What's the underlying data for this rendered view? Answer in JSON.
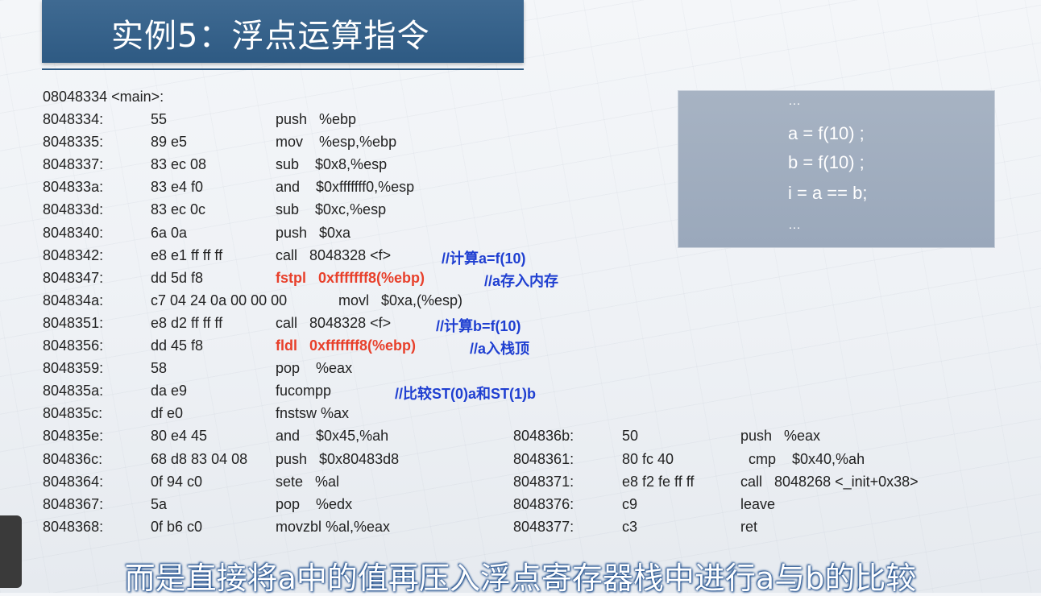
{
  "title": "实例5：浮点运算指令",
  "header_line": "08048334 <main>:",
  "code_left": [
    {
      "addr": "8048334:",
      "bytes": "55",
      "asm": "push   %ebp",
      "comment": ""
    },
    {
      "addr": "8048335:",
      "bytes": "89 e5",
      "asm": "mov    %esp,%ebp",
      "comment": ""
    },
    {
      "addr": "8048337:",
      "bytes": "83 ec 08",
      "asm": "sub    $0x8,%esp",
      "comment": ""
    },
    {
      "addr": "804833a:",
      "bytes": "83 e4 f0",
      "asm": "and    $0xfffffff0,%esp",
      "comment": ""
    },
    {
      "addr": "804833d:",
      "bytes": "83 ec 0c",
      "asm": "sub    $0xc,%esp",
      "comment": ""
    },
    {
      "addr": "8048340:",
      "bytes": "6a 0a",
      "asm": "push   $0xa",
      "comment": ""
    },
    {
      "addr": "8048342:",
      "bytes": "e8 e1 ff ff ff",
      "asm": "call   8048328 <f>",
      "comment": "//计算a=f(10)"
    },
    {
      "addr": "8048347:",
      "bytes": "dd 5d f8",
      "asm": "fstpl   0xfffffff8(%ebp)",
      "comment": "//a存入内存",
      "red": true
    },
    {
      "addr": "804834a:",
      "bytes": "c7 04 24 0a 00 00 00",
      "asm": "movl   $0xa,(%esp)",
      "comment": ""
    },
    {
      "addr": "8048351:",
      "bytes": "e8 d2 ff ff ff",
      "asm": "call   8048328 <f>",
      "comment": "//计算b=f(10)"
    },
    {
      "addr": "8048356:",
      "bytes": "dd 45 f8",
      "asm": "fldl   0xfffffff8(%ebp)",
      "comment": "//a入栈顶",
      "red": true
    },
    {
      "addr": "8048359:",
      "bytes": "58",
      "asm": "pop    %eax",
      "comment": ""
    },
    {
      "addr": "804835a:",
      "bytes": "da e9",
      "asm": "fucompp",
      "comment": "//比较ST(0)a和ST(1)b"
    },
    {
      "addr": "804835c:",
      "bytes": "df e0",
      "asm": "fnstsw %ax",
      "comment": ""
    },
    {
      "addr": "804835e:",
      "bytes": "80 e4 45",
      "asm": "and    $0x45,%ah",
      "comment": ""
    },
    {
      "addr": "804836c:",
      "bytes": "68 d8 83 04 08",
      "asm": "push   $0x80483d8",
      "comment": ""
    },
    {
      "addr": "8048364:",
      "bytes": "0f 94 c0",
      "asm": "sete   %al",
      "comment": ""
    },
    {
      "addr": "8048367:",
      "bytes": "5a",
      "asm": "pop    %edx",
      "comment": ""
    },
    {
      "addr": "8048368:",
      "bytes": "0f b6 c0",
      "asm": "movzbl %al,%eax",
      "comment": ""
    }
  ],
  "code_right": [
    {
      "addr": "804836b:",
      "bytes": "50",
      "asm": "push   %eax"
    },
    {
      "addr": "8048361:",
      "bytes": "80 fc 40",
      "asm": "cmp    $0x40,%ah"
    },
    {
      "addr": "8048371:",
      "bytes": "e8 f2 fe ff ff",
      "asm": "call   8048268 <_init+0x38>"
    },
    {
      "addr": "8048376:",
      "bytes": "c9",
      "asm": "leave"
    },
    {
      "addr": "8048377:",
      "bytes": "c3",
      "asm": "ret"
    }
  ],
  "side_box": [
    "…",
    "a = f(10) ;",
    "b = f(10) ;",
    "i = a == b;",
    "…"
  ],
  "subtitle": "而是直接将a中的值再压入浮点寄存器栈中进行a与b的比较"
}
